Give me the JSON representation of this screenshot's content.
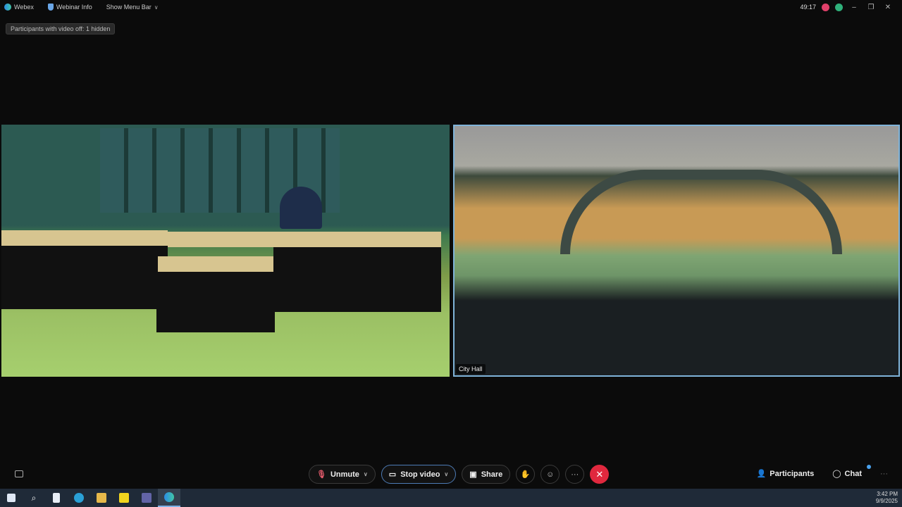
{
  "topbar": {
    "app": "Webex",
    "webinar_info": "Webinar Info",
    "show_menu_bar": "Show Menu Bar",
    "timer": "49:17"
  },
  "hidden_label": "Participants with video off: 1 hidden",
  "videos": [
    {
      "label": ""
    },
    {
      "label": "City Hall"
    }
  ],
  "controls": {
    "unmute": "Unmute",
    "stop_video": "Stop video",
    "share": "Share",
    "more": "···",
    "participants": "Participants",
    "chat": "Chat",
    "overflow": "···"
  },
  "taskbar": {
    "time": "3:42 PM",
    "date": "9/9/2025"
  },
  "colors": {
    "end_call": "#e0283e",
    "active_border": "#4d7bb5"
  }
}
